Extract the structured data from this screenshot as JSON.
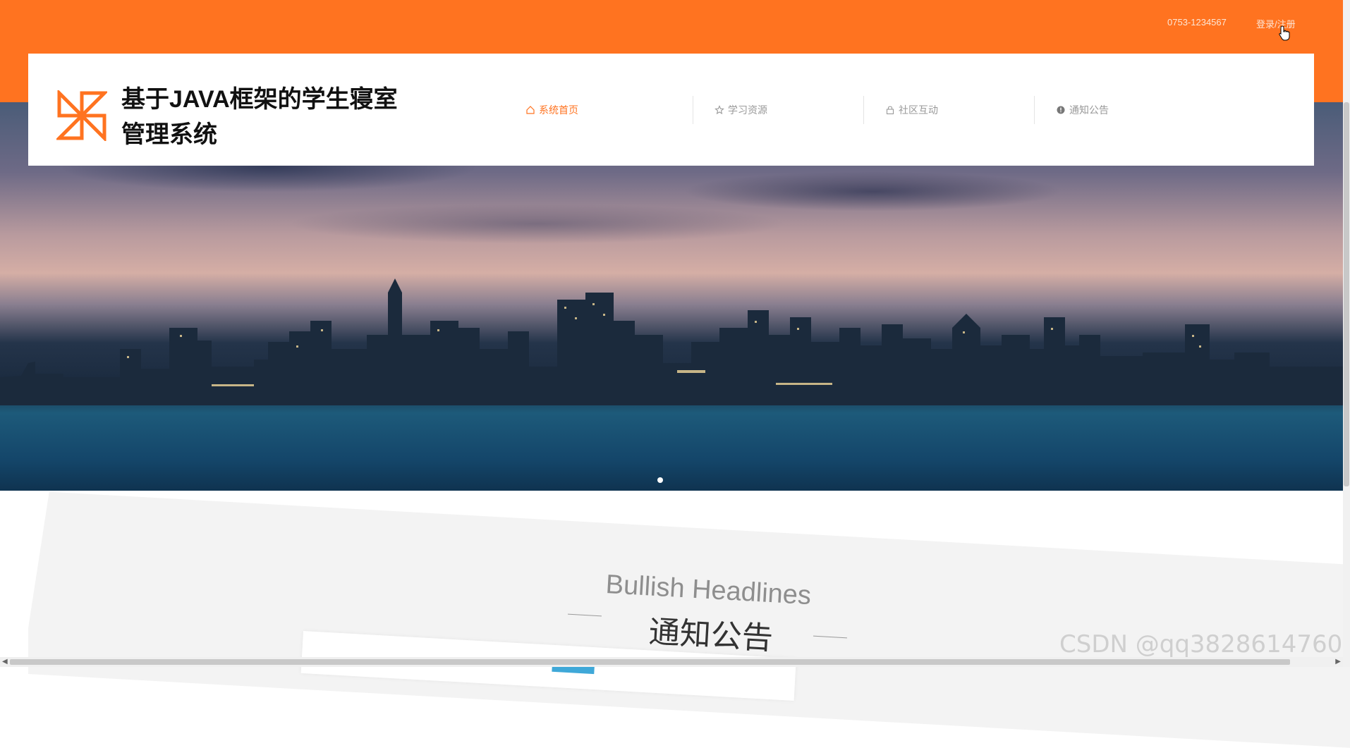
{
  "topbar": {
    "phone": "0753-1234567",
    "login": "登录/注册",
    "bg_color": "#ff7320"
  },
  "header": {
    "title_line1": "基于JAVA框架的学生寝室",
    "title_line2": "管理系统",
    "logo_icon": "pinwheel-logo-icon"
  },
  "nav": {
    "items": [
      {
        "label": "系统首页",
        "icon": "home-icon",
        "active": true
      },
      {
        "label": "学习资源",
        "icon": "star-icon",
        "active": false
      },
      {
        "label": "社区互动",
        "icon": "lock-icon",
        "active": false
      },
      {
        "label": "通知公告",
        "icon": "alert-circle-icon",
        "active": false
      }
    ],
    "active_color": "#ff7320"
  },
  "banner": {
    "slide_count": 1,
    "current_slide": 1
  },
  "section": {
    "title_en": "Bullish Headlines",
    "title_cn": "通知公告"
  },
  "watermark": "CSDN @qq3828614760"
}
